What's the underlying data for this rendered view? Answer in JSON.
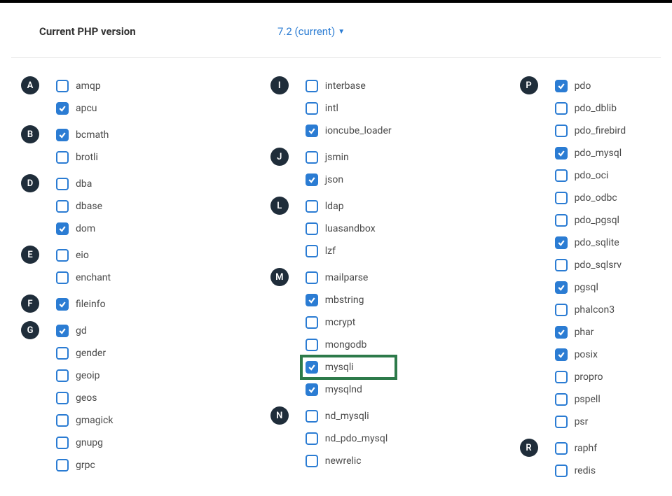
{
  "header": {
    "label": "Current PHP version",
    "version": "7.2 (current)"
  },
  "columns": [
    [
      {
        "letter": "A",
        "items": [
          {
            "label": "amqp",
            "checked": false
          },
          {
            "label": "apcu",
            "checked": true
          }
        ]
      },
      {
        "letter": "B",
        "items": [
          {
            "label": "bcmath",
            "checked": true
          },
          {
            "label": "brotli",
            "checked": false
          }
        ]
      },
      {
        "letter": "D",
        "items": [
          {
            "label": "dba",
            "checked": false
          },
          {
            "label": "dbase",
            "checked": false
          },
          {
            "label": "dom",
            "checked": true
          }
        ]
      },
      {
        "letter": "E",
        "items": [
          {
            "label": "eio",
            "checked": false
          },
          {
            "label": "enchant",
            "checked": false
          }
        ]
      },
      {
        "letter": "F",
        "items": [
          {
            "label": "fileinfo",
            "checked": true
          }
        ]
      },
      {
        "letter": "G",
        "items": [
          {
            "label": "gd",
            "checked": true
          },
          {
            "label": "gender",
            "checked": false
          },
          {
            "label": "geoip",
            "checked": false
          },
          {
            "label": "geos",
            "checked": false
          },
          {
            "label": "gmagick",
            "checked": false
          },
          {
            "label": "gnupg",
            "checked": false
          },
          {
            "label": "grpc",
            "checked": false
          }
        ]
      }
    ],
    [
      {
        "letter": "I",
        "items": [
          {
            "label": "interbase",
            "checked": false
          },
          {
            "label": "intl",
            "checked": false
          },
          {
            "label": "ioncube_loader",
            "checked": true
          }
        ]
      },
      {
        "letter": "J",
        "items": [
          {
            "label": "jsmin",
            "checked": false
          },
          {
            "label": "json",
            "checked": true
          }
        ]
      },
      {
        "letter": "L",
        "items": [
          {
            "label": "ldap",
            "checked": false
          },
          {
            "label": "luasandbox",
            "checked": false
          },
          {
            "label": "lzf",
            "checked": false
          }
        ]
      },
      {
        "letter": "M",
        "items": [
          {
            "label": "mailparse",
            "checked": false
          },
          {
            "label": "mbstring",
            "checked": true
          },
          {
            "label": "mcrypt",
            "checked": false
          },
          {
            "label": "mongodb",
            "checked": false
          },
          {
            "label": "mysqli",
            "checked": true,
            "highlight": true
          },
          {
            "label": "mysqlnd",
            "checked": true
          }
        ]
      },
      {
        "letter": "N",
        "items": [
          {
            "label": "nd_mysqli",
            "checked": false
          },
          {
            "label": "nd_pdo_mysql",
            "checked": false
          },
          {
            "label": "newrelic",
            "checked": false
          }
        ]
      }
    ],
    [
      {
        "letter": "P",
        "items": [
          {
            "label": "pdo",
            "checked": true
          },
          {
            "label": "pdo_dblib",
            "checked": false
          },
          {
            "label": "pdo_firebird",
            "checked": false
          },
          {
            "label": "pdo_mysql",
            "checked": true
          },
          {
            "label": "pdo_oci",
            "checked": false
          },
          {
            "label": "pdo_odbc",
            "checked": false
          },
          {
            "label": "pdo_pgsql",
            "checked": false
          },
          {
            "label": "pdo_sqlite",
            "checked": true
          },
          {
            "label": "pdo_sqlsrv",
            "checked": false
          },
          {
            "label": "pgsql",
            "checked": true
          },
          {
            "label": "phalcon3",
            "checked": false
          },
          {
            "label": "phar",
            "checked": true
          },
          {
            "label": "posix",
            "checked": true
          },
          {
            "label": "propro",
            "checked": false
          },
          {
            "label": "pspell",
            "checked": false
          },
          {
            "label": "psr",
            "checked": false
          }
        ]
      },
      {
        "letter": "R",
        "items": [
          {
            "label": "raphf",
            "checked": false
          },
          {
            "label": "redis",
            "checked": false
          }
        ]
      }
    ]
  ]
}
